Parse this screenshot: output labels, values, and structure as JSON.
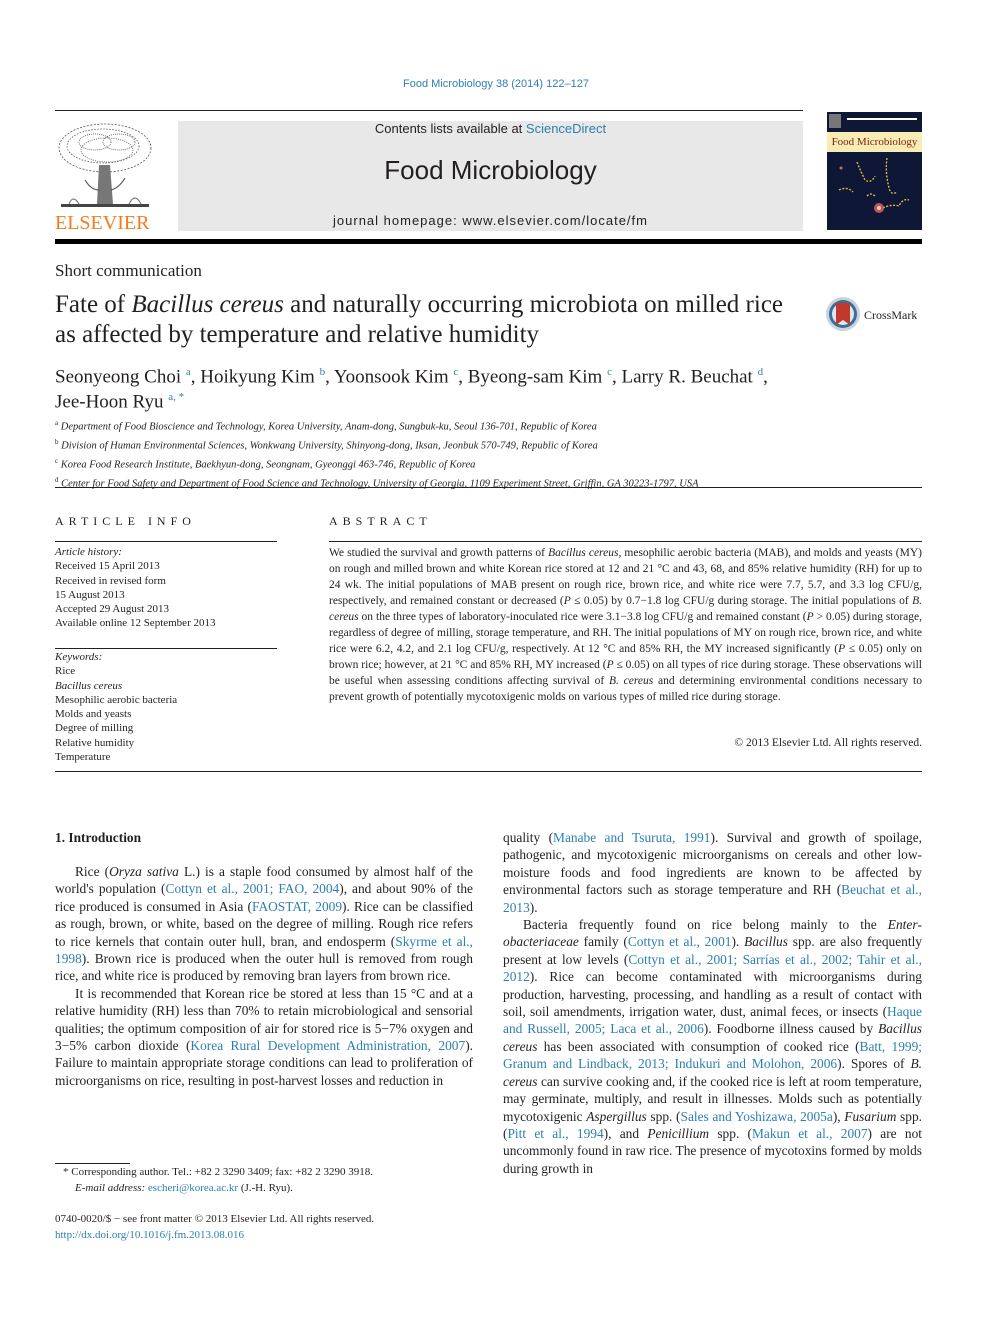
{
  "header": {
    "citation": "Food Microbiology 38 (2014) 122–127",
    "contents_prefix": "Contents lists available at ",
    "contents_link": "ScienceDirect",
    "journal_title": "Food Microbiology",
    "homepage": "journal homepage: www.elsevier.com/locate/fm",
    "publisher_logo_text": "ELSEVIER",
    "cover_title": "Food Microbiology",
    "colors": {
      "link": "#2e7fb0",
      "elsevier_orange": "#f47b20",
      "masthead_bg": "#e8e8e8"
    }
  },
  "article": {
    "type": "Short communication",
    "title_parts": [
      "Fate of ",
      "Bacillus cereus",
      " and naturally occurring microbiota on milled rice as affected by temperature and relative humidity"
    ],
    "crossmark_label": "CrossMark",
    "authors": [
      {
        "name": "Seonyeong Choi",
        "sup": "a"
      },
      {
        "name": "Hoikyung Kim",
        "sup": "b"
      },
      {
        "name": "Yoonsook Kim",
        "sup": "c"
      },
      {
        "name": "Byeong-sam Kim",
        "sup": "c"
      },
      {
        "name": "Larry R. Beuchat",
        "sup": "d"
      },
      {
        "name": "Jee-Hoon Ryu",
        "sup": "a, *"
      }
    ],
    "affiliations": [
      {
        "key": "a",
        "text": "Department of Food Bioscience and Technology, Korea University, Anam-dong, Sungbuk-ku, Seoul 136-701, Republic of Korea"
      },
      {
        "key": "b",
        "text": "Division of Human Environmental Sciences, Wonkwang University, Shinyong-dong, Iksan, Jeonbuk 570-749, Republic of Korea"
      },
      {
        "key": "c",
        "text": "Korea Food Research Institute, Baekhyun-dong, Seongnam, Gyeonggi 463-746, Republic of Korea"
      },
      {
        "key": "d",
        "text": "Center for Food Safety and Department of Food Science and Technology, University of Georgia, 1109 Experiment Street, Griffin, GA 30223-1797, USA"
      }
    ]
  },
  "article_info": {
    "heading": "ARTICLE INFO",
    "history_label": "Article history:",
    "history": [
      "Received 15 April 2013",
      "Received in revised form",
      "15 August 2013",
      "Accepted 29 August 2013",
      "Available online 12 September 2013"
    ],
    "keywords_label": "Keywords:",
    "keywords": [
      "Rice",
      "Bacillus cereus",
      "Mesophilic aerobic bacteria",
      "Molds and yeasts",
      "Degree of milling",
      "Relative humidity",
      "Temperature"
    ]
  },
  "abstract": {
    "heading": "ABSTRACT",
    "segments": [
      {
        "t": "We studied the survival and growth patterns of "
      },
      {
        "t": "Bacillus cereus",
        "i": true
      },
      {
        "t": ", mesophilic aerobic bacteria (MAB), and molds and yeasts (MY) on rough and milled brown and white Korean rice stored at 12 and 21 °C and 43, 68, and 85% relative humidity (RH) for up to 24 wk. The initial populations of MAB present on rough rice, brown rice, and white rice were 7.7, 5.7, and 3.3 log CFU/g, respectively, and remained constant or decreased ("
      },
      {
        "t": "P",
        "i": true
      },
      {
        "t": " ≤ 0.05) by 0.7−1.8 log CFU/g during storage. The initial populations of "
      },
      {
        "t": "B. cereus",
        "i": true
      },
      {
        "t": " on the three types of laboratory-inoculated rice were 3.1−3.8 log CFU/g and remained constant ("
      },
      {
        "t": "P",
        "i": true
      },
      {
        "t": " > 0.05) during storage, regardless of degree of milling, storage temperature, and RH. The initial populations of MY on rough rice, brown rice, and white rice were 6.2, 4.2, and 2.1 log CFU/g, respectively. At 12 °C and 85% RH, the MY increased significantly ("
      },
      {
        "t": "P",
        "i": true
      },
      {
        "t": " ≤ 0.05) only on brown rice; however, at 21 °C and 85% RH, MY increased ("
      },
      {
        "t": "P",
        "i": true
      },
      {
        "t": " ≤ 0.05) on all types of rice during storage. These observations will be useful when assessing conditions affecting survival of "
      },
      {
        "t": "B. cereus",
        "i": true
      },
      {
        "t": " and determining environmental conditions necessary to prevent growth of potentially mycotoxigenic molds on various types of milled rice during storage."
      }
    ],
    "copyright": "© 2013 Elsevier Ltd. All rights reserved."
  },
  "body": {
    "section_heading": "1.  Introduction",
    "left_paragraphs": [
      [
        {
          "t": "Rice ("
        },
        {
          "t": "Oryza sativa",
          "i": true
        },
        {
          "t": " L.) is a staple food consumed by almost half of the world's population ("
        },
        {
          "t": "Cottyn et al., 2001; FAO, 2004",
          "l": true
        },
        {
          "t": "), and about 90% of the rice produced is consumed in Asia ("
        },
        {
          "t": "FAOSTAT, 2009",
          "l": true
        },
        {
          "t": "). Rice can be classified as rough, brown, or white, based on the degree of milling. Rough rice refers to rice kernels that contain outer hull, bran, and endosperm ("
        },
        {
          "t": "Skyrme et al., 1998",
          "l": true
        },
        {
          "t": "). Brown rice is produced when the outer hull is removed from rough rice, and white rice is produced by removing bran layers from brown rice."
        }
      ],
      [
        {
          "t": "It is recommended that Korean rice be stored at less than 15 °C and at a relative humidity (RH) less than 70% to retain microbio­logical and sensorial qualities; the optimum composition of air for stored rice is 5−7% oxygen and 3−5% carbon dioxide ("
        },
        {
          "t": "Korea Rural Development Administration, 2007",
          "l": true
        },
        {
          "t": "). Failure to maintain appro­priate storage conditions can lead to proliferation of microorgan­isms on rice, resulting in post-harvest losses and reduction in"
        }
      ]
    ],
    "right_paragraphs": [
      [
        {
          "t": "quality ("
        },
        {
          "t": "Manabe and Tsuruta, 1991",
          "l": true
        },
        {
          "t": "). Survival and growth of spoilage, pathogenic, and mycotoxigenic microorganisms on ce­reals and other low-moisture foods and food ingredients are known to be affected by environmental factors such as storage tempera­ture and RH ("
        },
        {
          "t": "Beuchat et al., 2013",
          "l": true
        },
        {
          "t": ")."
        }
      ],
      [
        {
          "t": "Bacteria frequently found on rice belong mainly to the "
        },
        {
          "t": "Enter­obacteriaceae",
          "i": true
        },
        {
          "t": " family ("
        },
        {
          "t": "Cottyn et al., 2001",
          "l": true
        },
        {
          "t": "). "
        },
        {
          "t": "Bacillus",
          "i": true
        },
        {
          "t": " spp. are also frequently present at low levels ("
        },
        {
          "t": "Cottyn et al., 2001; Sarrías et al., 2002; Tahir et al., 2012",
          "l": true
        },
        {
          "t": "). Rice can become contaminated with mi­croorganisms during production, harvesting, processing, and handling as a result of contact with soil, soil amendments, irrigation water, dust, animal feces, or insects ("
        },
        {
          "t": "Haque and Russell, 2005; Laca et al., 2006",
          "l": true
        },
        {
          "t": "). Foodborne illness caused by "
        },
        {
          "t": "Bacillus cereus",
          "i": true
        },
        {
          "t": " has been associated with consumption of cooked rice ("
        },
        {
          "t": "Batt, 1999; Granum and Lindback, 2013; Indukuri and Molohon, 2006",
          "l": true
        },
        {
          "t": "). Spores of "
        },
        {
          "t": "B. cereus",
          "i": true
        },
        {
          "t": " can survive cooking and, if the cooked rice is left at room temperature, may germinate, multiply, and result in illnesses. Molds such as potentially mycotoxigenic "
        },
        {
          "t": "Aspergillus",
          "i": true
        },
        {
          "t": " spp. ("
        },
        {
          "t": "Sales and Yoshizawa, 2005a",
          "l": true
        },
        {
          "t": "), "
        },
        {
          "t": "Fusarium",
          "i": true
        },
        {
          "t": " spp. ("
        },
        {
          "t": "Pitt et al., 1994",
          "l": true
        },
        {
          "t": "), and "
        },
        {
          "t": "Penicillium",
          "i": true
        },
        {
          "t": " spp. ("
        },
        {
          "t": "Makun et al., 2007",
          "l": true
        },
        {
          "t": ") are not uncommonly found in raw rice. The presence of mycotoxins formed by molds during growth in"
        }
      ]
    ]
  },
  "footnote": {
    "marker": "*",
    "corresponding": "Corresponding author. Tel.: +82 2 3290 3409; fax: +82 2 3290 3918.",
    "email_label": "E-mail address:",
    "email": "escheri@korea.ac.kr",
    "email_suffix": " (J.-H. Ryu)."
  },
  "front_matter": {
    "issn_line": "0740-0020/$ − see front matter © 2013 Elsevier Ltd. All rights reserved.",
    "doi": "http://dx.doi.org/10.1016/j.fm.2013.08.016"
  }
}
